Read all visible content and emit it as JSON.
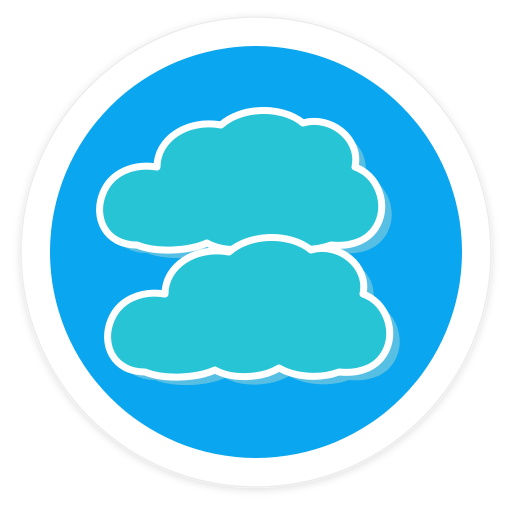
{
  "icon": {
    "name": "clouds-app-icon",
    "shape": "circle",
    "layers": [
      "outer-ring",
      "blue-disc",
      "top-cloud",
      "bottom-cloud"
    ]
  },
  "colors": {
    "page_background": "#ffffff",
    "ring": "#ffffff",
    "ring_shadow": "#e8e8e8",
    "disc": "#0aa6ef",
    "cloud_fill": "#27c4d6",
    "cloud_outline": "#ffffff",
    "cloud_shadow": "#56bfe3"
  }
}
